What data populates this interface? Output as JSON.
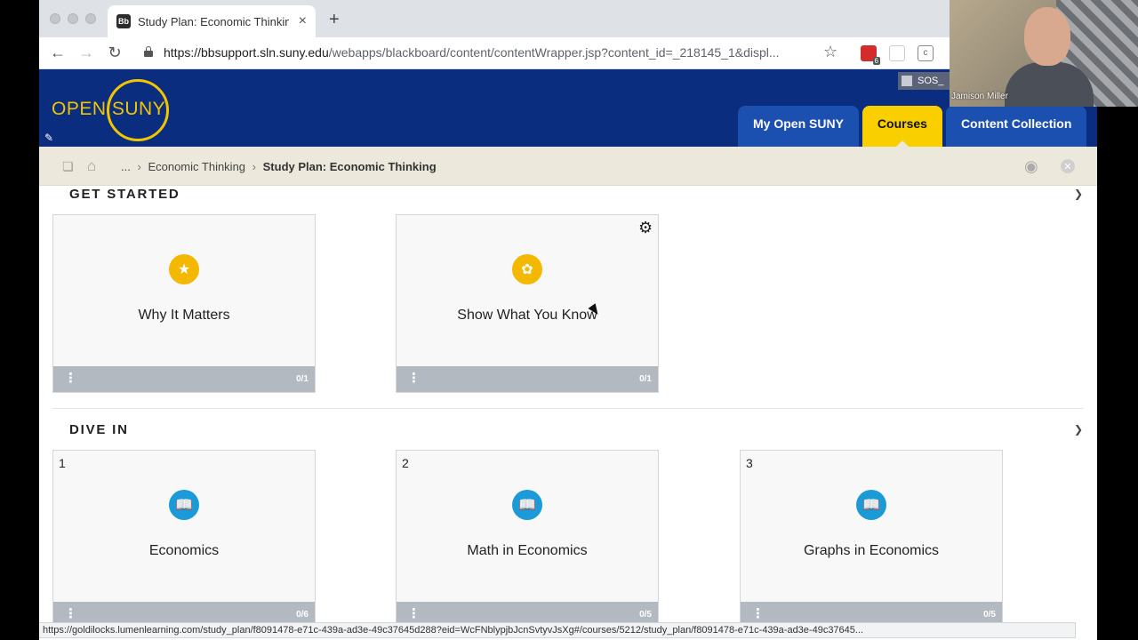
{
  "browser": {
    "tab_title": "Study Plan: Economic Thinking",
    "tab_favicon": "Bb",
    "tab_close": "×",
    "new_tab": "+",
    "url_host": "https://bbsupport.sln.suny.edu",
    "url_path": "/webapps/blackboard/content/contentWrapper.jsp?content_id=_218145_1&displ...",
    "extension_badge": "6",
    "status_url": "https://goldilocks.lumenlearning.com/study_plan/f8091478-e71c-439a-ad3e-49c37645d288?eid=WcFNblypjbJcnSvtyvJsXg#/courses/5212/study_plan/f8091478-e71c-439a-ad3e-49c37645..."
  },
  "header": {
    "logo_text": "OPEN SUNY",
    "sos_label": "SOS_",
    "nav": [
      {
        "label": "My Open SUNY"
      },
      {
        "label": "Courses"
      },
      {
        "label": "Content Collection"
      }
    ]
  },
  "breadcrumb": {
    "ellipsis": "...",
    "parent": "Economic Thinking",
    "current": "Study Plan: Economic Thinking"
  },
  "sections": [
    {
      "title": "GET STARTED",
      "cards": [
        {
          "number": "",
          "title": "Why It Matters",
          "count": "0/1",
          "icon": "star-icon"
        },
        {
          "number": "",
          "title": "Show What You Know",
          "count": "0/1",
          "icon": "brain-icon"
        }
      ]
    },
    {
      "title": "DIVE IN",
      "cards": [
        {
          "number": "1",
          "title": "Economics",
          "count": "0/6",
          "icon": "book-icon"
        },
        {
          "number": "2",
          "title": "Math in Economics",
          "count": "0/5",
          "icon": "book-icon"
        },
        {
          "number": "3",
          "title": "Graphs in Economics",
          "count": "0/5",
          "icon": "book-icon"
        }
      ]
    }
  ],
  "webcam": {
    "name": "Jamison Miller"
  },
  "colors": {
    "header_bg": "#0a2d80",
    "nav_tab": "#1b4fb0",
    "active_tab": "#f9cf00",
    "gold_icon": "#f5b800",
    "blue_icon": "#1a9ad6",
    "card_footer": "#b3b9c1"
  }
}
